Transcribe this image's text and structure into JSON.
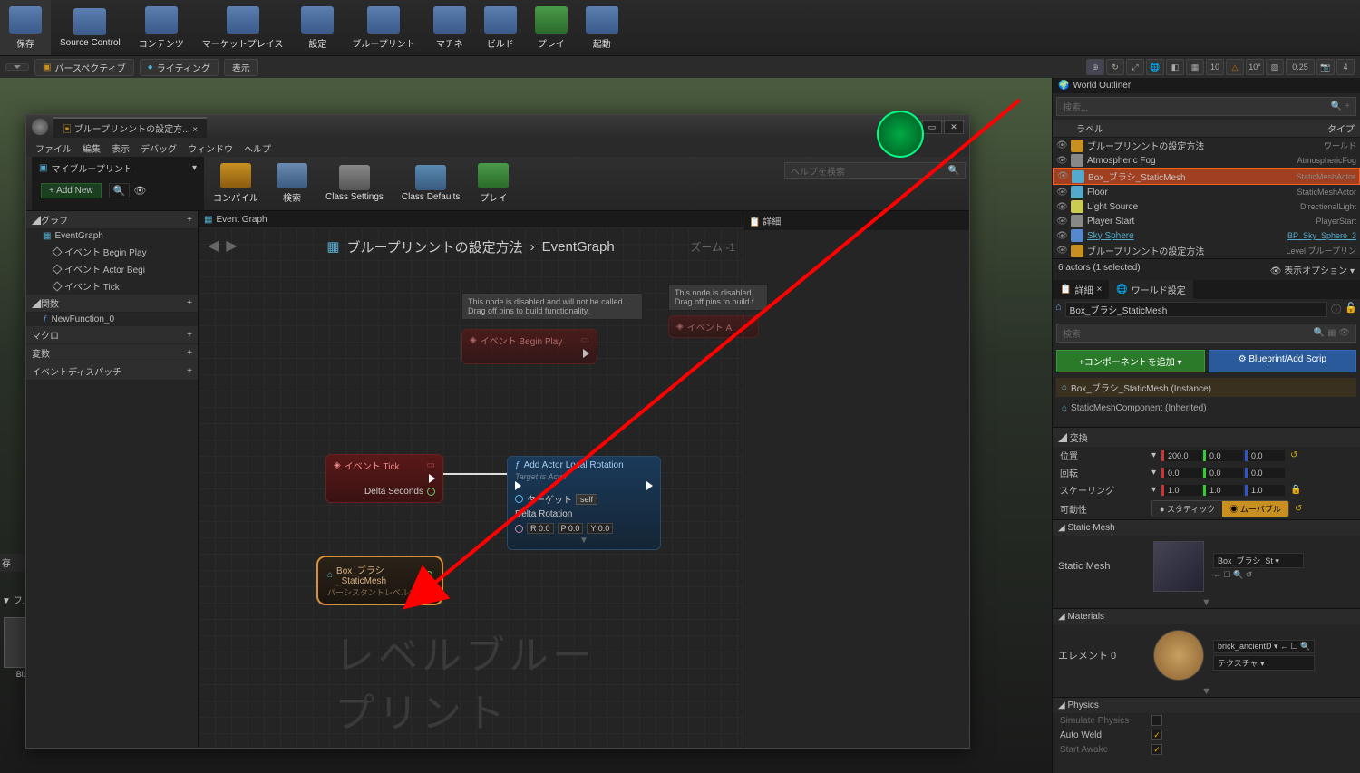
{
  "toolbar": [
    {
      "label": "保存"
    },
    {
      "label": "Source Control"
    },
    {
      "label": "コンテンツ"
    },
    {
      "label": "マーケットプレイス"
    },
    {
      "label": "設定"
    },
    {
      "label": "ブループリント"
    },
    {
      "label": "マチネ"
    },
    {
      "label": "ビルド"
    },
    {
      "label": "プレイ"
    },
    {
      "label": "起動"
    }
  ],
  "viewport": {
    "perspective": "パースペクティブ",
    "lighting": "ライティング",
    "show": "表示",
    "snap_pos": "10",
    "snap_rot": "10°",
    "snap_scale": "0.25",
    "cam_speed": "4"
  },
  "bp": {
    "tab": "ブループリンントの設定方...",
    "menu": [
      "ファイル",
      "編集",
      "表示",
      "デバッグ",
      "ウィンドウ",
      "ヘルプ"
    ],
    "search_help": "ヘルプを検索",
    "toolbar": [
      {
        "label": "コンパイル",
        "color": "linear-gradient(#c89020,#8a5a10)"
      },
      {
        "label": "検索",
        "color": "linear-gradient(#6a8ab0,#3a5a80)"
      },
      {
        "label": "Class Settings",
        "color": "linear-gradient(#888,#555)"
      },
      {
        "label": "Class Defaults",
        "color": "linear-gradient(#5a8ab0,#3a5a80)"
      },
      {
        "label": "プレイ",
        "color": "linear-gradient(#4a9a4a,#2a6a2a)"
      }
    ],
    "left": {
      "title": "マイブループリント",
      "addnew": "+ Add New",
      "cats": [
        {
          "name": "グラフ",
          "items": [
            {
              "name": "EventGraph",
              "sub": [
                "イベント Begin Play",
                "イベント Actor Begi",
                "イベント Tick"
              ]
            }
          ]
        },
        {
          "name": "関数",
          "items": [
            {
              "name": "NewFunction_0"
            }
          ]
        },
        {
          "name": "マクロ",
          "items": []
        },
        {
          "name": "変数",
          "items": []
        },
        {
          "name": "イベントディスパッチ",
          "items": []
        }
      ]
    },
    "graph": {
      "tab": "Event Graph",
      "crumb_a": "ブループリンントの設定方法",
      "crumb_b": "EventGraph",
      "zoom": "ズーム -1",
      "disabled_tip": "This node is disabled and will not be called. Drag off pins to build functionality.",
      "disabled_tip2": "This node is disabled. Drag off pins to build f",
      "node_beginplay": "イベント Begin Play",
      "node_actor": "イベント A",
      "node_tick": {
        "title": "イベント Tick",
        "pin": "Delta Seconds"
      },
      "node_add": {
        "title": "Add Actor Local Rotation",
        "sub": "Target is Actor",
        "target": "ターゲット",
        "self": "self",
        "delta": "Delta Rotation",
        "r": "R 0.0",
        "p": "P 0.0",
        "y": "Y 0.0"
      },
      "node_ref": {
        "title": "Box_ブラシ_StaticMesh",
        "sub": "パーシスタントレベルから"
      },
      "watermark": "レベルブループリント"
    },
    "detail_tab": "詳細"
  },
  "outliner": {
    "title": "World Outliner",
    "search": "検索...",
    "col_label": "ラベル",
    "col_type": "タイプ",
    "rows": [
      {
        "label": "ブループリンントの設定方法",
        "type": "ワールド",
        "ico": "#c89020"
      },
      {
        "label": "Atmospheric Fog",
        "type": "AtmosphericFog",
        "ico": "#888"
      },
      {
        "label": "Box_ブラシ_StaticMesh",
        "type": "StaticMeshActor",
        "ico": "#5ac",
        "sel": true
      },
      {
        "label": "Floor",
        "type": "StaticMeshActor",
        "ico": "#5ac"
      },
      {
        "label": "Light Source",
        "type": "DirectionalLight",
        "ico": "#cc5"
      },
      {
        "label": "Player Start",
        "type": "PlayerStart",
        "ico": "#888"
      },
      {
        "label": "Sky Sphere",
        "type": "BP_Sky_Sphere_3",
        "ico": "#58c",
        "link": true
      },
      {
        "label": "ブループリンントの設定方法",
        "type": "Level ブループリン",
        "ico": "#c89020"
      }
    ],
    "footer_count": "6 actors (1 selected)",
    "footer_view": "表示オプション"
  },
  "details": {
    "tab_detail": "詳細",
    "tab_world": "ワールド設定",
    "name": "Box_ブラシ_StaticMesh",
    "search": "検索",
    "btn_add": "+コンポーネントを追加",
    "btn_bp": "Blueprint/Add Scrip",
    "instance": "Box_ブラシ_StaticMesh (Instance)",
    "component": "StaticMeshComponent (Inherited)",
    "transform": {
      "section": "変換",
      "loc": "位置",
      "loc_x": "200.0",
      "loc_y": "0.0",
      "loc_z": "0.0",
      "rot": "回転",
      "rot_x": "0.0",
      "rot_y": "0.0",
      "rot_z": "0.0",
      "scale": "スケーリング",
      "scale_x": "1.0",
      "scale_y": "1.0",
      "scale_z": "1.0",
      "mobility": "可動性",
      "mob_static": "スタティック",
      "mob_movable": "ムーバブル"
    },
    "staticmesh": {
      "section": "Static Mesh",
      "label": "Static Mesh",
      "value": "Box_ブラシ_St"
    },
    "materials": {
      "section": "Materials",
      "elem": "エレメント 0",
      "value": "brick_ancientD",
      "tex": "テクスチャ"
    },
    "physics": {
      "section": "Physics",
      "sim": "Simulate Physics",
      "weld": "Auto Weld",
      "awake": "Start Awake"
    }
  },
  "cb": {
    "save": "存",
    "filter": "フ...",
    "item": "Bluep..."
  }
}
